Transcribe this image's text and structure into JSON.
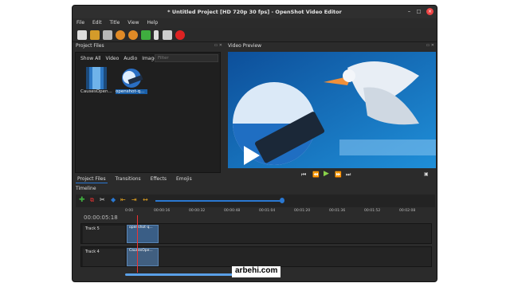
{
  "window": {
    "title": "* Untitled Project [HD 720p 30 fps] - OpenShot Video Editor"
  },
  "menu": [
    "File",
    "Edit",
    "Title",
    "View",
    "Help"
  ],
  "panes": {
    "project_files": "Project Files",
    "video_preview": "Video Preview",
    "timeline": "Timeline"
  },
  "files": {
    "filter_tabs": [
      "Show All",
      "Video",
      "Audio",
      "Image"
    ],
    "filter_placeholder": "Filter",
    "items": [
      {
        "label": "CausesOpen..."
      },
      {
        "label": "openshot-q..."
      }
    ]
  },
  "bottom_tabs": [
    "Project Files",
    "Transitions",
    "Effects",
    "Emojis"
  ],
  "timeline": {
    "time": "00:00:05:18",
    "ruler": [
      "0:00",
      "00:00:16",
      "00:00:32",
      "00:00:48",
      "00:01:04",
      "00:01:20",
      "00:01:36",
      "00:01:52",
      "00:02:08"
    ],
    "tracks": [
      {
        "name": "Track 5",
        "clip": "openshot-q..."
      },
      {
        "name": "Track 4",
        "clip": "CausesOpe..."
      }
    ]
  },
  "watermark": "arbehi.com"
}
